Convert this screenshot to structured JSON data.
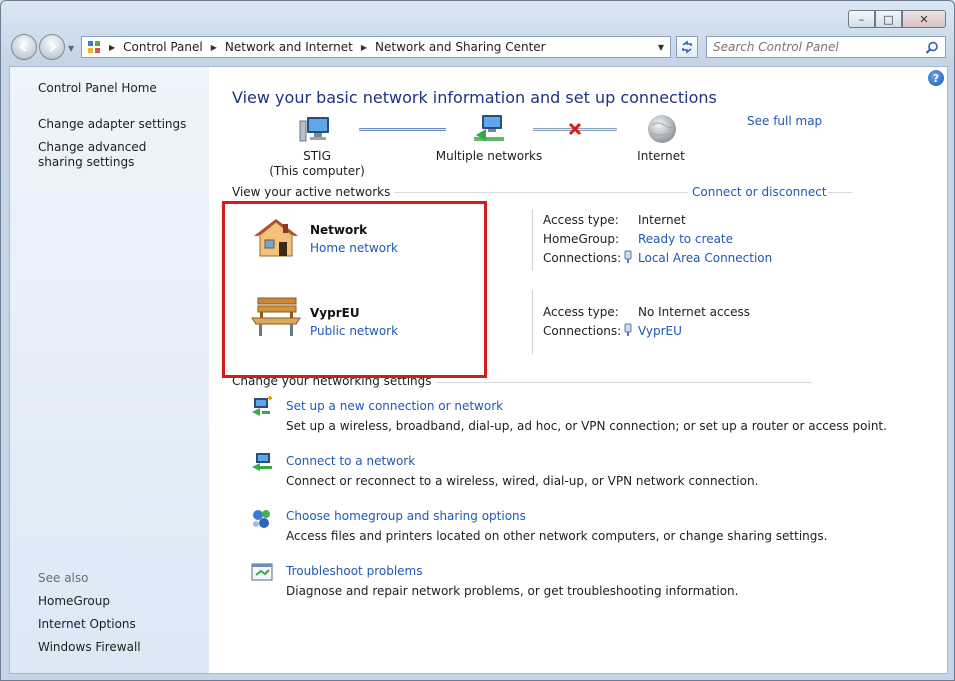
{
  "window": {
    "minimize_glyph": "–",
    "maximize_glyph": "□",
    "close_glyph": "✕"
  },
  "nav": {
    "breadcrumbs": [
      "Control Panel",
      "Network and Internet",
      "Network and Sharing Center"
    ],
    "search_placeholder": "Search Control Panel"
  },
  "sidebar": {
    "home": "Control Panel Home",
    "links": [
      "Change adapter settings",
      "Change advanced sharing settings"
    ],
    "see_also_label": "See also",
    "see_also": [
      "HomeGroup",
      "Internet Options",
      "Windows Firewall"
    ]
  },
  "main": {
    "help": "?",
    "title": "View your basic network information and set up connections",
    "see_full_map": "See full map",
    "map": {
      "computer_name": "STIG",
      "computer_sub": "(This computer)",
      "middle": "Multiple networks",
      "internet": "Internet"
    },
    "active_networks_label": "View your active networks",
    "connect_disconnect": "Connect or disconnect",
    "networks": [
      {
        "name": "Network",
        "type": "Home network",
        "access_label": "Access type:",
        "access_value": "Internet",
        "homegroup_label": "HomeGroup:",
        "homegroup_value": "Ready to create",
        "connections_label": "Connections:",
        "connections_value": "Local Area Connection"
      },
      {
        "name": "VyprEU",
        "type": "Public network",
        "access_label": "Access type:",
        "access_value": "No Internet access",
        "connections_label": "Connections:",
        "connections_value": "VyprEU"
      }
    ],
    "settings_label": "Change your networking settings",
    "tasks": [
      {
        "title": "Set up a new connection or network",
        "desc": "Set up a wireless, broadband, dial-up, ad hoc, or VPN connection; or set up a router or access point."
      },
      {
        "title": "Connect to a network",
        "desc": "Connect or reconnect to a wireless, wired, dial-up, or VPN network connection."
      },
      {
        "title": "Choose homegroup and sharing options",
        "desc": "Access files and printers located on other network computers, or change sharing settings."
      },
      {
        "title": "Troubleshoot problems",
        "desc": "Diagnose and repair network problems, or get troubleshooting information."
      }
    ]
  },
  "colors": {
    "link": "#1f58b5",
    "title": "#1e3287",
    "highlight_box": "#d61b1b"
  }
}
